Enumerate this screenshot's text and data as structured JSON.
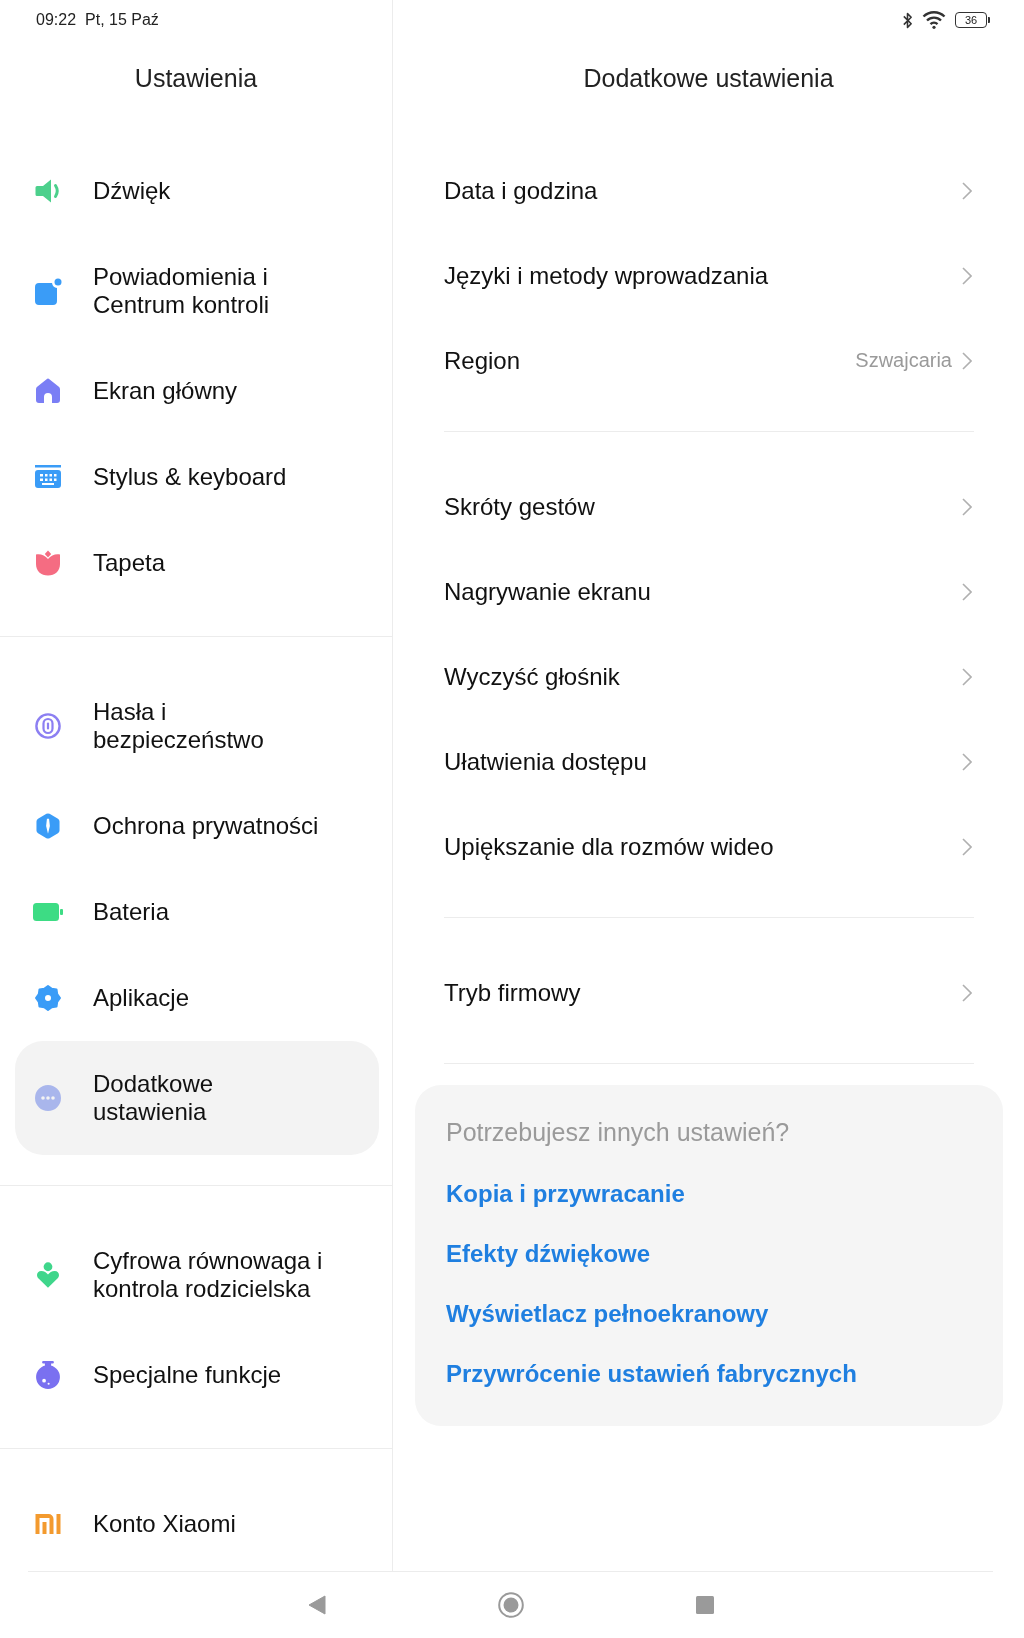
{
  "status_bar": {
    "time": "09:22",
    "date": "Pt, 15 Paź",
    "battery": "36"
  },
  "sidebar": {
    "title": "Ustawienia",
    "groups": [
      {
        "items": [
          {
            "label": "Dźwięk",
            "selected": false
          },
          {
            "label": "Powiadomienia i Centrum kontroli",
            "selected": false
          },
          {
            "label": "Ekran główny",
            "selected": false
          },
          {
            "label": "Stylus & keyboard",
            "selected": false
          },
          {
            "label": "Tapeta",
            "selected": false
          }
        ]
      },
      {
        "items": [
          {
            "label": "Hasła i bezpieczeństwo",
            "selected": false
          },
          {
            "label": "Ochrona prywatności",
            "selected": false
          },
          {
            "label": "Bateria",
            "selected": false
          },
          {
            "label": "Aplikacje",
            "selected": false
          },
          {
            "label": "Dodatkowe ustawienia",
            "selected": true
          }
        ]
      },
      {
        "items": [
          {
            "label": "Cyfrowa równowaga i kontrola rodzicielska",
            "selected": false
          },
          {
            "label": "Specjalne funkcje",
            "selected": false
          }
        ]
      },
      {
        "items": [
          {
            "label": "Konto Xiaomi",
            "selected": false
          }
        ]
      }
    ]
  },
  "detail": {
    "title": "Dodatkowe ustawienia",
    "groups": [
      {
        "items": [
          {
            "label": "Data i godzina"
          },
          {
            "label": "Języki i metody wprowadzania"
          },
          {
            "label": "Region",
            "value": "Szwajcaria"
          }
        ]
      },
      {
        "items": [
          {
            "label": "Skróty gestów"
          },
          {
            "label": "Nagrywanie ekranu"
          },
          {
            "label": "Wyczyść głośnik"
          },
          {
            "label": "Ułatwienia dostępu"
          },
          {
            "label": "Upiększanie dla rozmów wideo"
          }
        ]
      },
      {
        "items": [
          {
            "label": "Tryb firmowy"
          }
        ]
      }
    ],
    "suggestions": {
      "heading": "Potrzebujesz innych ustawień?",
      "links": [
        "Kopia i przywracanie",
        "Efekty dźwiękowe",
        "Wyświetlacz pełnoekranowy",
        "Przywrócenie ustawień fabrycznych"
      ]
    }
  }
}
